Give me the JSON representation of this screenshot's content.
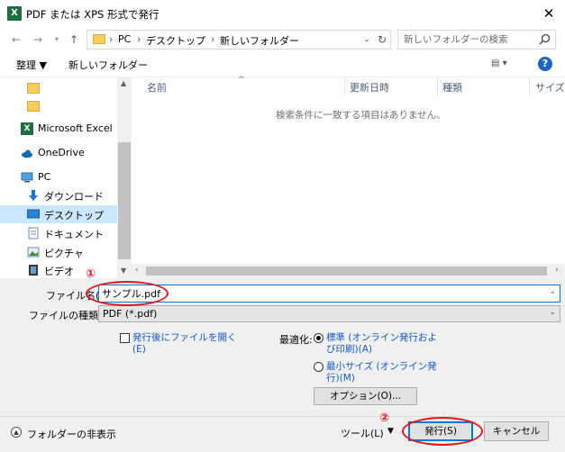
{
  "window": {
    "title": "PDF または XPS 形式で発行",
    "app_icon": "X"
  },
  "address": {
    "crumbs": [
      "PC",
      "デスクトップ",
      "新しいフォルダー"
    ],
    "search_placeholder": "新しいフォルダーの検索"
  },
  "toolbar": {
    "organize": "整理 ▼",
    "new_folder": "新しいフォルダー",
    "view": "▤ ▾"
  },
  "nav": {
    "items": [
      {
        "label": "",
        "icon": "folder-icon"
      },
      {
        "label": "",
        "icon": "folder-icon"
      },
      {
        "label": "Microsoft Excel",
        "icon": "excel-icon"
      },
      {
        "label": "OneDrive",
        "icon": "onedrive-icon"
      },
      {
        "label": "PC",
        "icon": "pc-icon"
      },
      {
        "label": "ダウンロード",
        "icon": "download-icon"
      },
      {
        "label": "デスクトップ",
        "icon": "desktop-icon"
      },
      {
        "label": "ドキュメント",
        "icon": "document-icon"
      },
      {
        "label": "ピクチャ",
        "icon": "picture-icon"
      },
      {
        "label": "ビデオ",
        "icon": "video-icon"
      }
    ]
  },
  "filelist": {
    "columns": [
      "名前",
      "更新日時",
      "種類",
      "サイズ"
    ],
    "empty_message": "検索条件に一致する項目はありません。"
  },
  "form": {
    "filename_label": "ファイル名(N):",
    "filename_value": "サンプル.pdf",
    "filetype_label": "ファイルの種類(T):",
    "filetype_value": "PDF (*.pdf)",
    "open_after_line1": "発行後にファイルを開く",
    "open_after_line2": "(E)",
    "optimize_label": "最適化:",
    "opt_standard_line1": "標準 (オンライン発行およ",
    "opt_standard_line2": "び印刷)(A)",
    "opt_min_line1": "最小サイズ (オンライン発",
    "opt_min_line2": "行)(M)",
    "options_button": "オプション(O)..."
  },
  "footer": {
    "hide_folders": "フォルダーの非表示",
    "tools": "ツール(L)",
    "publish": "発行(S)",
    "cancel": "キャンセル"
  },
  "annotations": {
    "num1": "①",
    "num2": "②",
    "color": "#e3141b"
  }
}
